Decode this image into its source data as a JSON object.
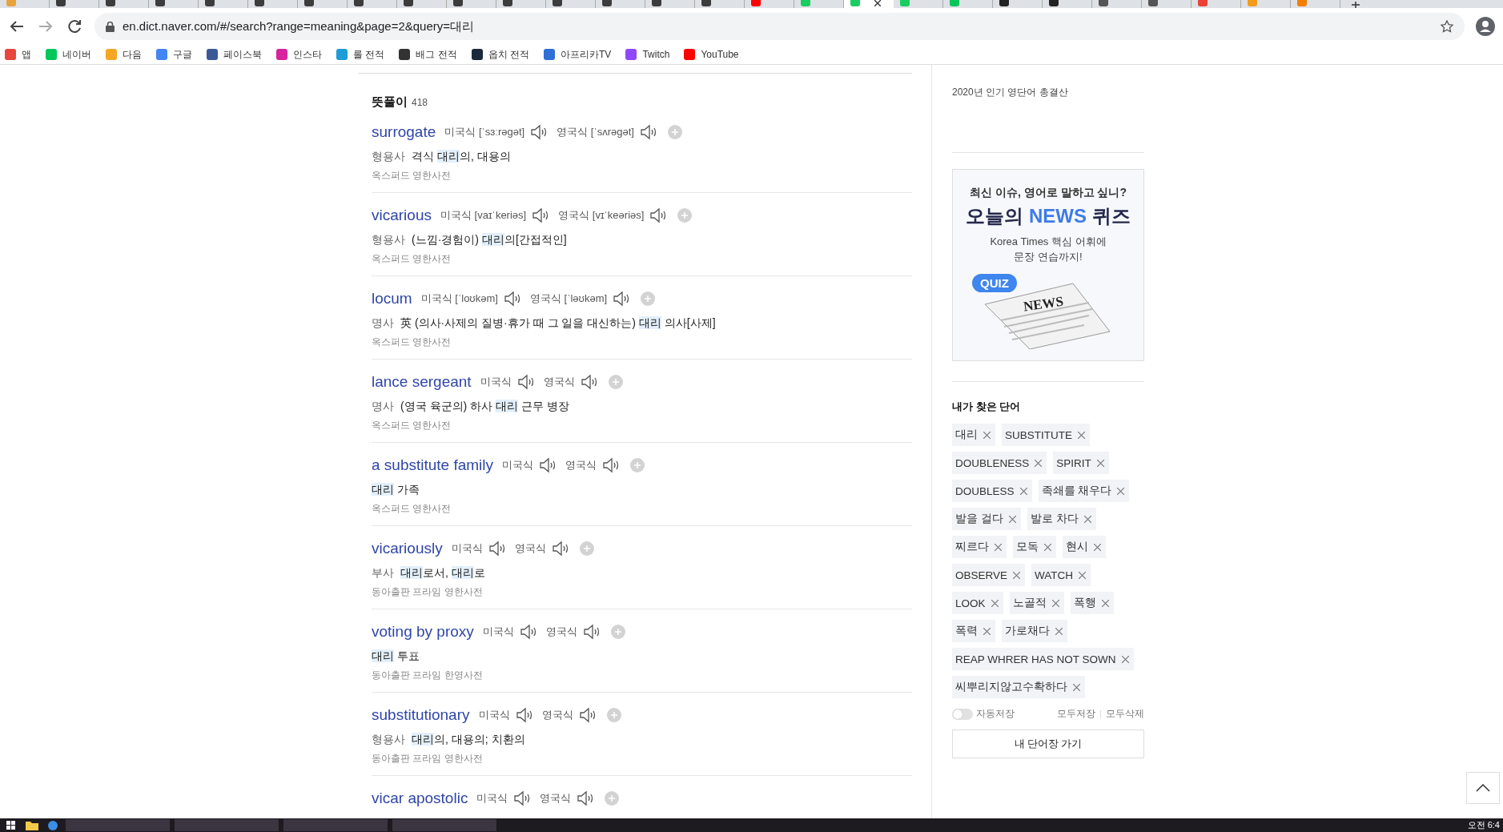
{
  "browser": {
    "tabs": [
      {
        "selected": false,
        "color": "#e8a33d"
      },
      {
        "selected": false,
        "color": "#3c3c3c"
      },
      {
        "selected": false,
        "color": "#3c3c3c"
      },
      {
        "selected": false,
        "color": "#3c3c3c"
      },
      {
        "selected": false,
        "color": "#3c3c3c"
      },
      {
        "selected": false,
        "color": "#3c3c3c"
      },
      {
        "selected": false,
        "color": "#3c3c3c"
      },
      {
        "selected": false,
        "color": "#3c3c3c"
      },
      {
        "selected": false,
        "color": "#3c3c3c"
      },
      {
        "selected": false,
        "color": "#3c3c3c"
      },
      {
        "selected": false,
        "color": "#3c3c3c"
      },
      {
        "selected": false,
        "color": "#3c3c3c"
      },
      {
        "selected": false,
        "color": "#3c3c3c"
      },
      {
        "selected": false,
        "color": "#3c3c3c"
      },
      {
        "selected": false,
        "color": "#3c3c3c"
      },
      {
        "selected": false,
        "color": "#ff0000"
      },
      {
        "selected": false,
        "color": "#19ce60"
      },
      {
        "selected": true,
        "color": "#19ce60"
      },
      {
        "selected": false,
        "color": "#19ce60"
      },
      {
        "selected": false,
        "color": "#03c75a"
      },
      {
        "selected": false,
        "color": "#222222"
      },
      {
        "selected": false,
        "color": "#222222"
      },
      {
        "selected": false,
        "color": "#555555"
      },
      {
        "selected": false,
        "color": "#555555"
      },
      {
        "selected": false,
        "color": "#ea4335"
      },
      {
        "selected": false,
        "color": "#f59b1c"
      },
      {
        "selected": false,
        "color": "#f57d00"
      }
    ],
    "url": "en.dict.naver.com/#/search?range=meaning&page=2&query=대리",
    "bookmarks": [
      {
        "label": "앱",
        "color": "#e8453c"
      },
      {
        "label": "네이버",
        "color": "#03c75a"
      },
      {
        "label": "다음",
        "color": "#f5a623"
      },
      {
        "label": "구글",
        "color": "#4285f4"
      },
      {
        "label": "페이스북",
        "color": "#3b5998"
      },
      {
        "label": "인스타",
        "color": "#d6249f"
      },
      {
        "label": "롤 전적",
        "color": "#1e9cd7"
      },
      {
        "label": "배그 전적",
        "color": "#333333"
      },
      {
        "label": "옵치 전적",
        "color": "#1a2a3a"
      },
      {
        "label": "아프리카TV",
        "color": "#2f6fd6"
      },
      {
        "label": "Twitch",
        "color": "#9146ff"
      },
      {
        "label": "YouTube",
        "color": "#ff0000"
      }
    ]
  },
  "results": {
    "title": "뜻풀이",
    "count": "418",
    "entries": [
      {
        "word": "surrogate",
        "us": "미국식 [ˈsɜːrəɡət]",
        "uk": "영국식 [ˈsʌrəɡət]",
        "pos": "형용사",
        "parts": [
          {
            "text": "격식 ",
            "hl": false
          },
          {
            "text": "대리",
            "hl": true
          },
          {
            "text": "의, 대용의",
            "hl": false
          }
        ],
        "source": "옥스퍼드 영한사전"
      },
      {
        "word": "vicarious",
        "us": "미국식 [vaɪˈkeriəs]",
        "uk": "영국식 [vɪˈkeəriəs]",
        "pos": "형용사",
        "parts": [
          {
            "text": "(느낌·경험이) ",
            "hl": false
          },
          {
            "text": "대리",
            "hl": true
          },
          {
            "text": "의[간접적인]",
            "hl": false
          }
        ],
        "source": "옥스퍼드 영한사전"
      },
      {
        "word": "locum",
        "us": "미국식 [ˈloʊkəm]",
        "uk": "영국식 [ˈləʊkəm]",
        "pos": "명사",
        "parts": [
          {
            "text": "英 (의사·사제의 질병·휴가 때 그 일을 대신하는) ",
            "hl": false
          },
          {
            "text": "대리",
            "hl": true
          },
          {
            "text": " 의사[사제]",
            "hl": false
          }
        ],
        "source": "옥스퍼드 영한사전"
      },
      {
        "word": "lance sergeant",
        "us": "미국식",
        "uk": "영국식",
        "pos": "명사",
        "parts": [
          {
            "text": "(영국 육군의) 하사 ",
            "hl": false
          },
          {
            "text": "대리",
            "hl": true
          },
          {
            "text": " 근무 병장",
            "hl": false
          }
        ],
        "source": "옥스퍼드 영한사전"
      },
      {
        "word": "a substitute family",
        "us": "미국식",
        "uk": "영국식",
        "parts": [
          {
            "text": "대리",
            "hl": true
          },
          {
            "text": " 가족",
            "hl": false
          }
        ],
        "source": "옥스퍼드 영한사전"
      },
      {
        "word": "vicariously",
        "us": "미국식",
        "uk": "영국식",
        "pos": "부사",
        "parts": [
          {
            "text": "대리",
            "hl": true
          },
          {
            "text": "로서, ",
            "hl": false
          },
          {
            "text": "대리",
            "hl": true
          },
          {
            "text": "로",
            "hl": false
          }
        ],
        "source": "동아출판 프라임 영한사전"
      },
      {
        "word": "voting by proxy",
        "us": "미국식",
        "uk": "영국식",
        "parts": [
          {
            "text": "대리",
            "hl": true
          },
          {
            "text": " 투표",
            "hl": false
          }
        ],
        "source": "동아출판 프라임 한영사전"
      },
      {
        "word": "substitutionary",
        "us": "미국식",
        "uk": "영국식",
        "pos": "형용사",
        "parts": [
          {
            "text": "대리",
            "hl": true
          },
          {
            "text": "의, 대용의; 치환의",
            "hl": false
          }
        ],
        "source": "동아출판 프라임 영한사전"
      },
      {
        "word": "vicar apostolic",
        "us": "미국식",
        "uk": "영국식"
      }
    ]
  },
  "sidebar": {
    "promo_link": "2020년 인기 영단어 총결산",
    "ad": {
      "line1": "최신 이슈, 영어로 말하고 싶니?",
      "headline": [
        {
          "text": "오늘의 ",
          "accent": false
        },
        {
          "text": "NEWS",
          "accent": true
        },
        {
          "text": " 퀴즈",
          "accent": false
        }
      ],
      "line3": "Korea Times 핵심 어휘에",
      "line4": "문장 연습까지!",
      "bubble": "QUIZ",
      "paper": "NEWS"
    },
    "history_title": "내가 찾은 단어",
    "words": [
      "대리",
      "SUBSTITUTE",
      "DOUBLENESS",
      "SPIRIT",
      "DOUBLESS",
      "족쇄를 채우다",
      "발을 걸다",
      "발로 차다",
      "찌르다",
      "모독",
      "현시",
      "OBSERVE",
      "WATCH",
      "LOOK",
      "노골적",
      "폭행",
      "폭력",
      "가로채다",
      "REAP WHRER HAS NOT SOWN",
      "씨뿌리지않고수확하다"
    ],
    "autosave": {
      "label": "자동저장",
      "on": false
    },
    "save_all": "모두저장",
    "delete_all": "모두삭제",
    "wordbook_button": "내 단어장 가기"
  },
  "taskbar": {
    "clock": "오전 6:4"
  }
}
